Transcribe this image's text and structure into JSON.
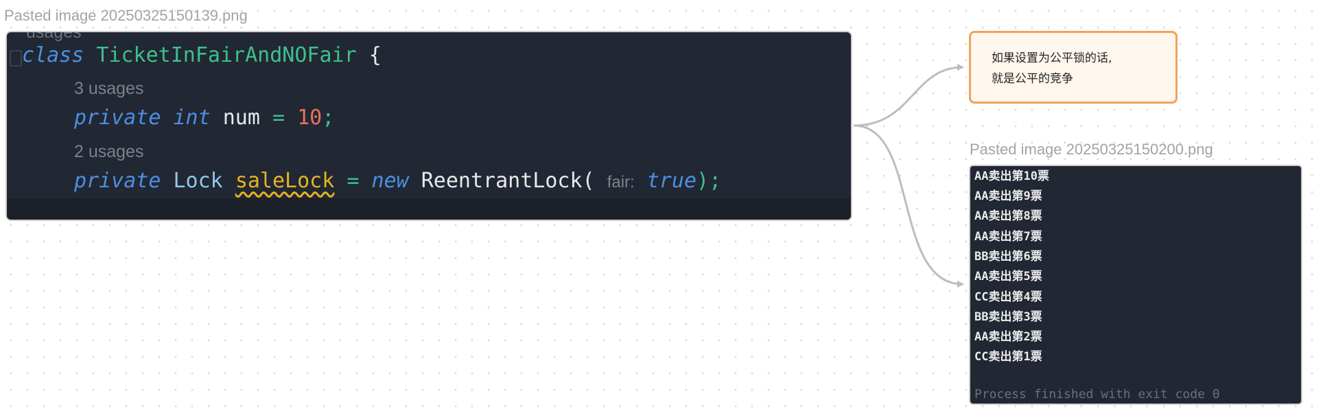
{
  "code_image": {
    "caption": "Pasted image 20250325150139.png",
    "cut_top_label": "usages",
    "class_line": {
      "kw": "class",
      "name": "TicketInFairAndNOFair",
      "brace": "{"
    },
    "hint1": "3 usages",
    "line1": {
      "kw1": "private",
      "kw2": "int",
      "field": "num",
      "eq": "=",
      "value": "10",
      "semi": ";"
    },
    "hint2": "2 usages",
    "line2": {
      "kw1": "private",
      "type": "Lock",
      "field": "saleLock",
      "eq": "=",
      "kw_new": "new",
      "ctor": "ReentrantLock(",
      "param_hint": "fair:",
      "arg": "true",
      "end": ");"
    }
  },
  "note": {
    "line1": "如果设置为公平锁的话,",
    "line2": "就是公平的竞争",
    "border_color": "#f0a35a"
  },
  "console_image": {
    "caption": "Pasted image 20250325150200.png",
    "lines": [
      "AA卖出第10票",
      "AA卖出第9票",
      "AA卖出第8票",
      "AA卖出第7票",
      "BB卖出第6票",
      "AA卖出第5票",
      "CC卖出第4票",
      "BB卖出第3票",
      "AA卖出第2票",
      "CC卖出第1票"
    ],
    "process": "Process finished with exit code 0"
  },
  "colors": {
    "editor_bg": "#212733",
    "keyword": "#4c8fe0",
    "class_name": "#3fbf8c",
    "number": "#e8735a",
    "warning": "#e6b422",
    "edge": "#bdbdbd"
  }
}
